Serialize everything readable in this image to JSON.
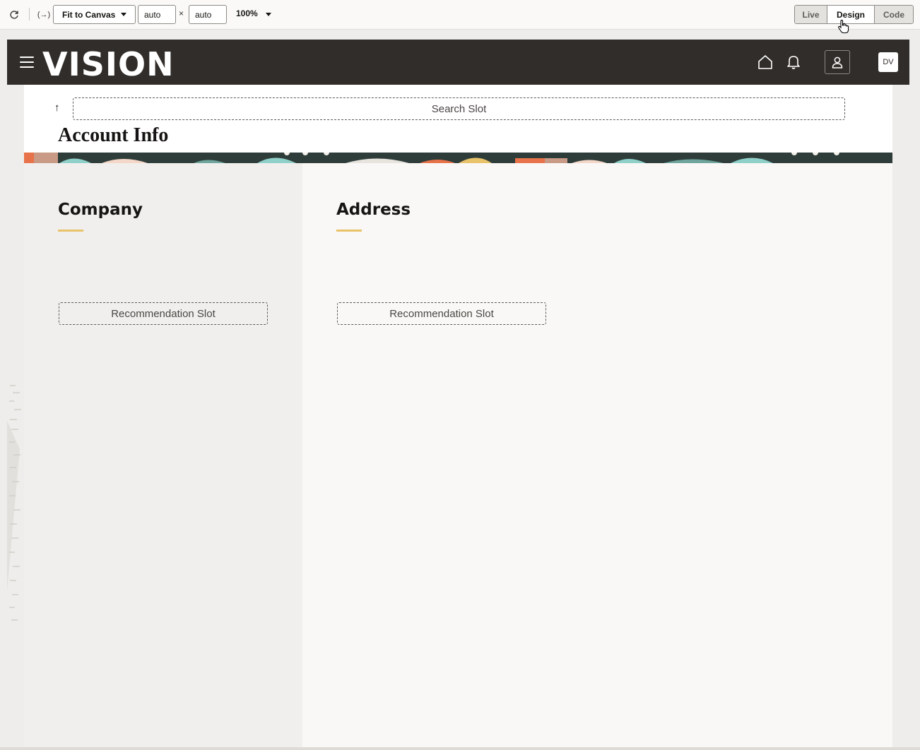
{
  "toolbar": {
    "refresh_icon": "refresh-icon",
    "variables_icon": "variables-icon",
    "variables_glyph": "(→)",
    "fit_select": "Fit to Canvas",
    "width_value": "auto",
    "height_value": "auto",
    "times_sign": "×",
    "zoom": "100%",
    "modes": {
      "live": "Live",
      "design": "Design",
      "code": "Code"
    },
    "active_mode": "Design"
  },
  "app": {
    "logo": "VISION",
    "avatar_initials": "DV",
    "header_color": "#312d2a",
    "accent_color": "#e9c36a"
  },
  "page": {
    "back_glyph": "↑",
    "search_slot": "Search Slot",
    "title": "Account Info"
  },
  "sections": {
    "company": {
      "title": "Company",
      "slot": "Recommendation Slot"
    },
    "address": {
      "title": "Address",
      "slot": "Recommendation Slot"
    }
  }
}
